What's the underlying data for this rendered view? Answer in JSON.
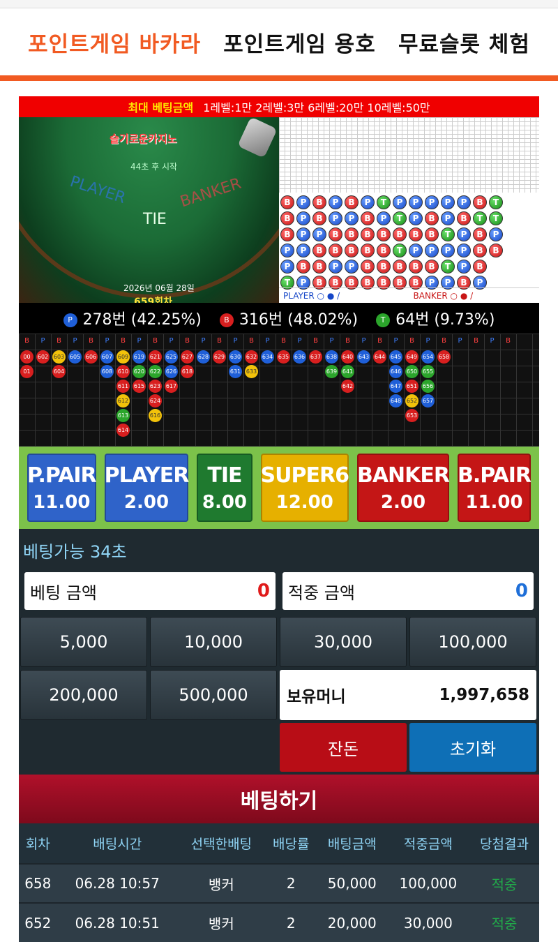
{
  "nav": {
    "tabs": [
      "포인트게임 바카라",
      "포인트게임 용호",
      "무료슬롯 체험"
    ],
    "active": 0
  },
  "maxbet": {
    "title": "최대 베팅금액",
    "levels": "1레벨:1만 2레벨:3만 6레벨:20만 10레벨:50만"
  },
  "table": {
    "logo": "슬기로운카지노",
    "countdown": "44초 후 시작",
    "player_label": "PLAYER",
    "tie_label": "TIE",
    "banker_label": "BANKER",
    "date": "2026년 06월 28일",
    "round": "659회차"
  },
  "bead_rows": [
    [
      "B",
      "P",
      "B",
      "P",
      "B",
      "P",
      "T",
      "P",
      "P",
      "P",
      "P",
      "P",
      "B",
      "T"
    ],
    [
      "B",
      "P",
      "B",
      "P",
      "P",
      "B",
      "P",
      "T",
      "P",
      "B",
      "P",
      "B",
      "T",
      "T"
    ],
    [
      "B",
      "P",
      "P",
      "B",
      "B",
      "B",
      "B",
      "B",
      "B",
      "B",
      "T",
      "P",
      "B",
      "P"
    ],
    [
      "P",
      "P",
      "B",
      "B",
      "B",
      "B",
      "B",
      "T",
      "P",
      "P",
      "P",
      "P",
      "B",
      "B"
    ],
    [
      "P",
      "B",
      "B",
      "P",
      "P",
      "B",
      "B",
      "B",
      "B",
      "B",
      "T",
      "P",
      "B"
    ],
    [
      "T",
      "P",
      "B",
      "B",
      "B",
      "B",
      "B",
      "B",
      "B",
      "P",
      "P",
      "B",
      "P"
    ]
  ],
  "board_legend": {
    "player": "PLAYER",
    "banker": "BANKER"
  },
  "stats": [
    {
      "dot": "P",
      "color": "#1f5fd8",
      "text": "278번 (42.25%)"
    },
    {
      "dot": "B",
      "color": "#d81f1f",
      "text": "316번 (48.02%)"
    },
    {
      "dot": "T",
      "color": "#2ba52b",
      "text": "64번 (9.73%)"
    }
  ],
  "history_head": [
    "B",
    "P",
    "B",
    "P",
    "B",
    "P",
    "B",
    "P",
    "B",
    "P",
    "B",
    "P",
    "B",
    "P",
    "B",
    "P",
    "B",
    "P",
    "B",
    "P",
    "B",
    "P",
    "B",
    "P",
    "B",
    "P",
    "B",
    "P",
    "B",
    "P",
    "B"
  ],
  "history_cols": [
    [
      [
        "00",
        "B"
      ],
      [
        "01",
        "B"
      ]
    ],
    [
      [
        "602",
        "B"
      ]
    ],
    [
      [
        "603",
        "Y"
      ],
      [
        "604",
        "B"
      ]
    ],
    [
      [
        "605",
        "P"
      ]
    ],
    [
      [
        "606",
        "B"
      ]
    ],
    [
      [
        "607",
        "P"
      ],
      [
        "608",
        "P"
      ]
    ],
    [
      [
        "609",
        "Y"
      ],
      [
        "610",
        "B"
      ],
      [
        "611",
        "B"
      ],
      [
        "612",
        "Y"
      ],
      [
        "613",
        "T"
      ],
      [
        "614",
        "B"
      ]
    ],
    [
      [
        "619",
        "P"
      ],
      [
        "620",
        "T"
      ],
      [
        "615",
        "B"
      ]
    ],
    [
      [
        "621",
        "B"
      ],
      [
        "622",
        "T"
      ],
      [
        "623",
        "B"
      ],
      [
        "624",
        "B"
      ],
      [
        "616",
        "Y"
      ]
    ],
    [
      [
        "625",
        "P"
      ],
      [
        "626",
        "P"
      ],
      [
        "617",
        "B"
      ]
    ],
    [
      [
        "627",
        "B"
      ],
      [
        "618",
        "B"
      ]
    ],
    [
      [
        "628",
        "P"
      ]
    ],
    [
      [
        "629",
        "B"
      ]
    ],
    [
      [
        "630",
        "P"
      ],
      [
        "631",
        "P"
      ]
    ],
    [
      [
        "632",
        "B"
      ],
      [
        "633",
        "Y"
      ]
    ],
    [
      [
        "634",
        "P"
      ]
    ],
    [
      [
        "635",
        "B"
      ]
    ],
    [
      [
        "636",
        "P"
      ]
    ],
    [
      [
        "637",
        "B"
      ]
    ],
    [
      [
        "638",
        "P"
      ],
      [
        "639",
        "T"
      ]
    ],
    [
      [
        "640",
        "B"
      ],
      [
        "641",
        "T"
      ],
      [
        "642",
        "B"
      ]
    ],
    [
      [
        "643",
        "P"
      ]
    ],
    [
      [
        "644",
        "B"
      ]
    ],
    [
      [
        "645",
        "P"
      ],
      [
        "646",
        "P"
      ],
      [
        "647",
        "P"
      ],
      [
        "648",
        "P"
      ]
    ],
    [
      [
        "649",
        "B"
      ],
      [
        "650",
        "T"
      ],
      [
        "651",
        "B"
      ],
      [
        "652",
        "Y"
      ],
      [
        "653",
        "B"
      ]
    ],
    [
      [
        "654",
        "P"
      ],
      [
        "655",
        "T"
      ],
      [
        "656",
        "T"
      ],
      [
        "657",
        "P"
      ]
    ],
    [
      [
        "658",
        "B"
      ]
    ]
  ],
  "bets": [
    {
      "name": "P.PAIR",
      "odds": "11.00",
      "cls": "bp"
    },
    {
      "name": "PLAYER",
      "odds": "2.00",
      "cls": "bl"
    },
    {
      "name": "TIE",
      "odds": "8.00",
      "cls": "bt"
    },
    {
      "name": "SUPER6",
      "odds": "12.00",
      "cls": "bs"
    },
    {
      "name": "BANKER",
      "odds": "2.00",
      "cls": "bb"
    },
    {
      "name": "B.PAIR",
      "odds": "11.00",
      "cls": "bbp"
    }
  ],
  "panel": {
    "avail": "베팅가능 34초",
    "bet_amount_label": "베팅 금액",
    "bet_amount": "0",
    "win_amount_label": "적중 금액",
    "win_amount": "0",
    "chips": [
      "5,000",
      "10,000",
      "30,000",
      "100,000",
      "200,000",
      "500,000"
    ],
    "wallet_label": "보유머니",
    "wallet_value": "1,997,658",
    "change_btn": "잔돈",
    "reset_btn": "초기화",
    "submit": "베팅하기"
  },
  "history_table": {
    "headers": [
      "회차",
      "배팅시간",
      "선택한배팅",
      "배당률",
      "배팅금액",
      "적중금액",
      "당첨결과"
    ],
    "rows": [
      [
        "658",
        "06.28 10:57",
        "뱅커",
        "2",
        "50,000",
        "100,000",
        "적중"
      ],
      [
        "652",
        "06.28 10:51",
        "뱅커",
        "2",
        "20,000",
        "30,000",
        "적중"
      ]
    ]
  }
}
